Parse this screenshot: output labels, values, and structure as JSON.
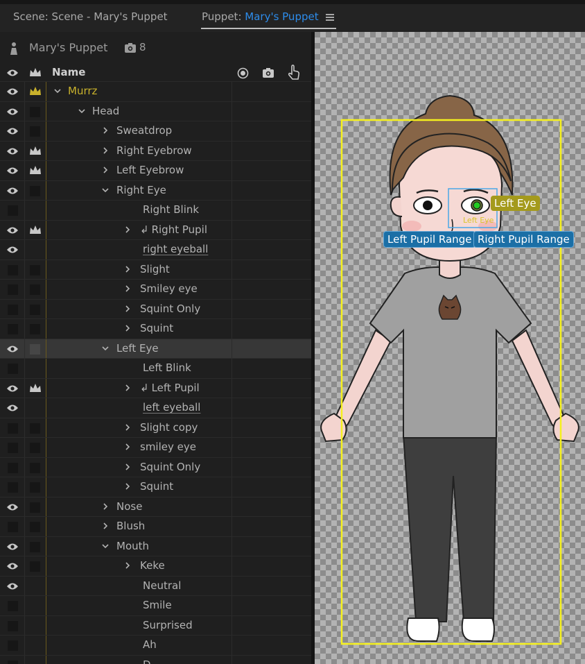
{
  "tabs": {
    "scene": "Scene: Scene - Mary's Puppet",
    "puppet_prefix": "Puppet: ",
    "puppet_name": "Mary's Puppet"
  },
  "panel": {
    "puppet_name": "Mary's Puppet",
    "camera_count": "8",
    "column_name": "Name"
  },
  "rows": [
    {
      "label": "Murrz",
      "vis": "eye",
      "crown": "gold",
      "chev": "down",
      "indent": 0,
      "style": "gold"
    },
    {
      "label": "Head",
      "vis": "eye",
      "crown": "box",
      "chev": "down",
      "indent": 1
    },
    {
      "label": "Sweatdrop",
      "vis": "eye",
      "crown": "box",
      "chev": "right",
      "indent": 2
    },
    {
      "label": "Right Eyebrow",
      "vis": "eye",
      "crown": "crown",
      "chev": "right",
      "indent": 2
    },
    {
      "label": "Left Eyebrow",
      "vis": "eye",
      "crown": "crown",
      "chev": "right",
      "indent": 2
    },
    {
      "label": "Right Eye",
      "vis": "eye",
      "crown": "box",
      "chev": "down",
      "indent": 2
    },
    {
      "label": "Right Blink",
      "vis": "box",
      "crown": "none",
      "chev": "none",
      "indent": 3
    },
    {
      "label": "Right Pupil",
      "vis": "eye",
      "crown": "crown",
      "chev": "right",
      "indent": 3,
      "pin": true
    },
    {
      "label": "right eyeball",
      "vis": "eye",
      "crown": "none",
      "chev": "none",
      "indent": 3,
      "style": "ul"
    },
    {
      "label": "Slight",
      "vis": "box",
      "crown": "box",
      "chev": "right",
      "indent": 3
    },
    {
      "label": "Smiley eye",
      "vis": "box",
      "crown": "box",
      "chev": "right",
      "indent": 3
    },
    {
      "label": "Squint Only",
      "vis": "box",
      "crown": "box",
      "chev": "right",
      "indent": 3
    },
    {
      "label": "Squint",
      "vis": "box",
      "crown": "box",
      "chev": "right",
      "indent": 3
    },
    {
      "label": "Left Eye",
      "vis": "eye",
      "crown": "box",
      "chev": "down",
      "indent": 2,
      "selected": true
    },
    {
      "label": "Left Blink",
      "vis": "box",
      "crown": "none",
      "chev": "none",
      "indent": 3
    },
    {
      "label": "Left Pupil",
      "vis": "eye",
      "crown": "crown",
      "chev": "right",
      "indent": 3,
      "pin": true
    },
    {
      "label": "left eyeball",
      "vis": "eye",
      "crown": "none",
      "chev": "none",
      "indent": 3,
      "style": "ul"
    },
    {
      "label": "Slight copy",
      "vis": "box",
      "crown": "box",
      "chev": "right",
      "indent": 3
    },
    {
      "label": "smiley eye",
      "vis": "box",
      "crown": "box",
      "chev": "right",
      "indent": 3
    },
    {
      "label": "Squint Only",
      "vis": "box",
      "crown": "box",
      "chev": "right",
      "indent": 3
    },
    {
      "label": "Squint",
      "vis": "box",
      "crown": "box",
      "chev": "right",
      "indent": 3
    },
    {
      "label": "Nose",
      "vis": "eye",
      "crown": "box",
      "chev": "right",
      "indent": 2
    },
    {
      "label": "Blush",
      "vis": "box",
      "crown": "box",
      "chev": "right",
      "indent": 2
    },
    {
      "label": "Mouth",
      "vis": "eye",
      "crown": "box",
      "chev": "down",
      "indent": 2
    },
    {
      "label": "Keke",
      "vis": "eye",
      "crown": "box",
      "chev": "right",
      "indent": 3
    },
    {
      "label": "Neutral",
      "vis": "eye",
      "crown": "none",
      "chev": "none",
      "indent": 3
    },
    {
      "label": "Smile",
      "vis": "box",
      "crown": "none",
      "chev": "none",
      "indent": 3
    },
    {
      "label": "Surprised",
      "vis": "box",
      "crown": "none",
      "chev": "none",
      "indent": 3
    },
    {
      "label": "Ah",
      "vis": "box",
      "crown": "none",
      "chev": "none",
      "indent": 3
    },
    {
      "label": "D",
      "vis": "box",
      "crown": "none",
      "chev": "none",
      "indent": 3
    }
  ],
  "stage": {
    "tags": {
      "left_eye": "Left Eye",
      "left_eye_small": "Left Eye",
      "left_pupil_range": "Left Pupil Range",
      "right_pupil_range": "Right Pupil Range"
    }
  },
  "colors": {
    "accent_blue": "#2d8ceb",
    "group_gold": "#c9b22c",
    "bounds_yellow": "#f5f01e"
  }
}
